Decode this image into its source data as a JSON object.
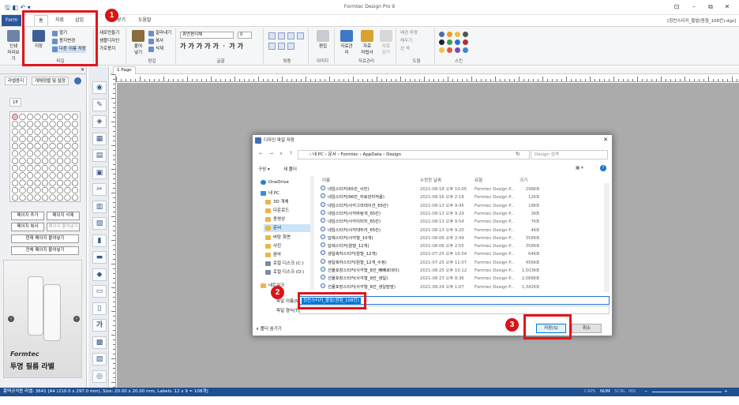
{
  "titlebar": {
    "title": "Formtec Design Pro 9",
    "quick_access": "🖫 ◧ ↶ ▾",
    "doc_name": "[칭찬스티커_물발(원형_108칸).dgz]",
    "win_controls": [
      "⊡",
      "–",
      "⧉",
      "✕"
    ]
  },
  "ribbon_tabs": [
    {
      "label": "Form"
    },
    {
      "label": "홈"
    },
    {
      "label": "자료"
    },
    {
      "label": "삽입"
    },
    {
      "label": "보기"
    },
    {
      "label": "도움말"
    }
  ],
  "ribbon": {
    "file": {
      "save": "저장",
      "open": "열기",
      "reopen_bottom": "파일",
      "print_label": "인쇄\n미리보기",
      "open_list": "열기",
      "save_big": "저장",
      "new_form": "용지변경",
      "save_as": "다른 이름 저장",
      "group": "파일"
    },
    "sample": {
      "items": [
        "새로만들기",
        "샘플디자인",
        "가로용지"
      ]
    },
    "edit": {
      "paste": "붙여\n넣기",
      "cut": "잘라내기",
      "copy": "복사",
      "delete": "삭제",
      "group": "편집"
    },
    "font": {
      "name": "휴먼편지체",
      "size": "0",
      "styles": [
        "가",
        "가",
        "가",
        "가",
        "가",
        "ㆍ",
        "가",
        "가"
      ],
      "group": "글꼴"
    },
    "align": {
      "group": "맞춤"
    },
    "image": {
      "edit": "편집",
      "group": "이미지"
    },
    "data": {
      "manage": "자료관리",
      "merge": "자료\n마법사",
      "close": "자료\n닫기",
      "group": "자료관리"
    },
    "shape": {
      "items": [
        "배경 투명",
        "채우기",
        "선 색"
      ],
      "group": "도형"
    },
    "style": {
      "group": "스킨"
    }
  },
  "left_panel": {
    "tabs": [
      "라벨용지",
      "개체정렬 및 설정"
    ],
    "page_tab": "1P",
    "buttons": {
      "add_page": "페이지 추가",
      "delete_page": "페이지 삭제",
      "copy_page": "페이지 복사",
      "paste_page": "페이지 붙여넣기",
      "paste_current": "현재 페이지 붙여넣기",
      "paste_all": "전체 페이지 붙여넣기"
    },
    "ad": {
      "brand": "Formtec",
      "caption": "투명 필름 라벨"
    }
  },
  "doc_tab": "1 Page",
  "statusbar": {
    "left": "폼텍규격용 라벨: 3641 [A4 (210.0 x 297.0 mm), Size: 20.00 x 20.00 mm,  Labels: 12 x 9 = 108개]",
    "caps": "CAPS",
    "num": "NUM",
    "scrl": "SCRL",
    "ins": "INS",
    "zoom_minus": "−",
    "zoom_plus": "+"
  },
  "dialog": {
    "title": "디자인 파일 저장",
    "close": "✕",
    "nav_arrows": "← → ∨ ↑",
    "breadcrumb": "› 내 PC  ›  문서  ›  Formtec  ›  AppData  ›  Design",
    "refresh": "↻",
    "search_placeholder": "Design 검색",
    "organize": "구성 ▾",
    "new_folder": "새 폴더",
    "view": "▦ ▾",
    "help": "?",
    "nav_items": [
      {
        "label": "OneDrive"
      },
      {
        "label": "내 PC"
      },
      {
        "label": "3D 개체"
      },
      {
        "label": "다운로드"
      },
      {
        "label": "동영상"
      },
      {
        "label": "문서"
      },
      {
        "label": "바탕 화면"
      },
      {
        "label": "사진"
      },
      {
        "label": "음악"
      },
      {
        "label": "로컬 디스크 (C:)"
      },
      {
        "label": "로컬 디스크 (D:)"
      },
      {
        "label": "네트워크"
      }
    ],
    "columns": [
      "이름",
      "수정한 날짜",
      "유형",
      "크기"
    ],
    "files": [
      {
        "name": "네임스티커(65칸_사진)",
        "date": "2021-08-18 오후 10:05",
        "type": "Formtec Design P...",
        "size": "298KB"
      },
      {
        "name": "네임스티커(96칸_자료관리적용)",
        "date": "2021-08-16 오후 2:18",
        "type": "Formtec Design P...",
        "size": "12KB"
      },
      {
        "name": "네임스티커(사각그라데이션_65칸)",
        "date": "2021-08-13 오후 9:45",
        "type": "Formtec Design P...",
        "size": "18KB"
      },
      {
        "name": "네임스티커(사각바탕색_65칸)",
        "date": "2021-08-13 오후 9:29",
        "type": "Formtec Design P...",
        "size": "3KB"
      },
      {
        "name": "네임스티커(사각이미지_65칸)",
        "date": "2021-08-13 오후 9:54",
        "type": "Formtec Design P...",
        "size": "7KB"
      },
      {
        "name": "네임스티커(사각테두리_65칸)",
        "date": "2021-08-13 오후 9:20",
        "type": "Formtec Design P...",
        "size": "4KB"
      },
      {
        "name": "답례스티커(사각형_10개)",
        "date": "2021-08-06 오후 2:49",
        "type": "Formtec Design P...",
        "size": "358KB"
      },
      {
        "name": "답례스티커(원형_12개)",
        "date": "2021-08-06 오후 2:55",
        "type": "Formtec Design P...",
        "size": "358KB"
      },
      {
        "name": "생일축하스티커(원형_12개)",
        "date": "2021-07-25 오후 10:54",
        "type": "Formtec Design P...",
        "size": "64KB"
      },
      {
        "name": "생일축하스티커(원형_12개_수정)",
        "date": "2021-07-25 오후 11:07",
        "type": "Formtec Design P...",
        "size": "456KB"
      },
      {
        "name": "선물포장스티커(사각형_8칸_빼빼로데이)",
        "date": "2021-08-25 오후 10:12",
        "type": "Formtec Design P...",
        "size": "1,503KB"
      },
      {
        "name": "선물포장스티커(사각형_8칸_생일)",
        "date": "2021-08-23 오후 8:36",
        "type": "Formtec Design P...",
        "size": "2,088KB"
      },
      {
        "name": "선물포장스티커(사각형_8칸_생일맘맘)",
        "date": "2021-08-24 오후 1:07",
        "type": "Formtec Design P...",
        "size": "1,342KB"
      }
    ],
    "filename_label": "파일 이름(N):",
    "filename_value": "칭찬스티커_물발(원형_108칸)",
    "filetype_label": "파일 형식(T):",
    "filetype_value": "",
    "hide_folders": "∧ 폴더 숨기기",
    "save_button": "저장(S)",
    "cancel_button": "취소"
  },
  "annotations": {
    "badge1": "1",
    "badge2": "2",
    "badge3": "3"
  },
  "colors": {
    "accent": "#2b579a",
    "highlight_red": "#e0161b",
    "status_bar": "#1e4f8f"
  }
}
